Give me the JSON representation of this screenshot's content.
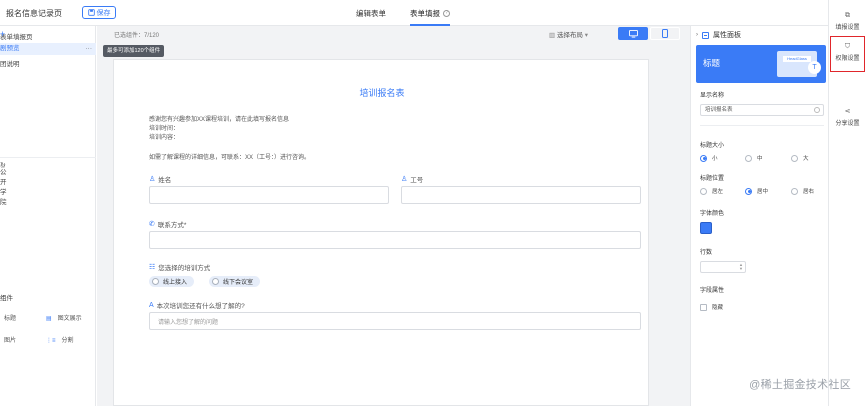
{
  "header": {
    "app_title": "报名信息记录页",
    "save_label": "保存",
    "tabs": [
      {
        "label": "编辑表单",
        "active": false
      },
      {
        "label": "表单填报",
        "active": true
      }
    ],
    "help_glyph": "?"
  },
  "left_panel": {
    "section_title": "表单填报页",
    "add_glyph": "+",
    "items": [
      {
        "label": "剧预览",
        "active": true,
        "more_glyph": "···"
      },
      {
        "label": "团说明",
        "active": false
      }
    ],
    "settings_section": {
      "label": "公开学院",
      "info_glyph": "⊙",
      "refresh_glyph": "↻"
    },
    "components_section": {
      "label": "组件",
      "toggle_glyph": "⌄",
      "rows": [
        {
          "left": "标题",
          "left_icon": "title-icon",
          "right": "图文展示",
          "right_icon": "rich-text-icon"
        },
        {
          "left": "图片",
          "left_icon": "image-icon",
          "right": "分割",
          "right_icon": "divider-icon"
        }
      ]
    }
  },
  "canvas": {
    "count_text": "已选组件：7/120",
    "tooltip": "最多可添加120个组件",
    "layout_select": "选择布局",
    "view_modes": [
      {
        "name": "desktop",
        "icon": "monitor-icon",
        "active": true
      },
      {
        "name": "mobile",
        "icon": "phone-icon",
        "active": false
      }
    ],
    "form": {
      "title": "培训报名表",
      "description_lines": [
        "感谢您有兴趣参加XX课程培训，请在此填写报名信息",
        "培训时间：",
        "培训内容："
      ],
      "contact_line": "如需了解课程的详细信息，可联系：XX（工号：）进行咨询。",
      "fields": [
        {
          "label": "姓名",
          "icon": "user-icon",
          "placeholder": ""
        },
        {
          "label": "工号",
          "icon": "user-icon",
          "placeholder": ""
        },
        {
          "label": "联系方式*",
          "icon": "phone-icon",
          "placeholder": ""
        },
        {
          "label": "您选择的培训方式",
          "icon": "radio-list-icon",
          "options": [
            "线上接入",
            "线下会议室"
          ]
        },
        {
          "label": "本次培训您还有什么想了解的?",
          "icon": "text-icon",
          "placeholder": "请输入您想了解的问题"
        }
      ]
    }
  },
  "property_panel": {
    "title": "属性面板",
    "banner_title": "标题",
    "banner_card_text": "HeadGlass",
    "banner_circle_glyph": "T",
    "display_name_label": "显示名称",
    "display_name_value": "培训报名表",
    "title_size_label": "标题大小",
    "title_size_options": [
      {
        "label": "小",
        "selected": true
      },
      {
        "label": "中",
        "selected": false
      },
      {
        "label": "大",
        "selected": false
      }
    ],
    "title_position_label": "标题位置",
    "title_position_options": [
      {
        "label": "居左",
        "selected": false
      },
      {
        "label": "居中",
        "selected": true
      },
      {
        "label": "居右",
        "selected": false
      }
    ],
    "font_color_label": "字体颜色",
    "font_color": "#3a7bf6",
    "rows_label": "行数",
    "field_attr_label": "字段属性",
    "hide_label": "隐藏"
  },
  "rail": [
    {
      "label": "填报设置",
      "icon": "form-settings-icon",
      "highlighted": false
    },
    {
      "label": "权限设置",
      "icon": "shield-icon",
      "highlighted": true
    },
    {
      "label": "分享设置",
      "icon": "share-icon",
      "highlighted": false
    }
  ],
  "watermark": "@稀土掘金技术社区",
  "colors": {
    "accent": "#3a7bf6",
    "highlight_border": "#e0262b",
    "canvas_bg": "#f2f3f5"
  }
}
